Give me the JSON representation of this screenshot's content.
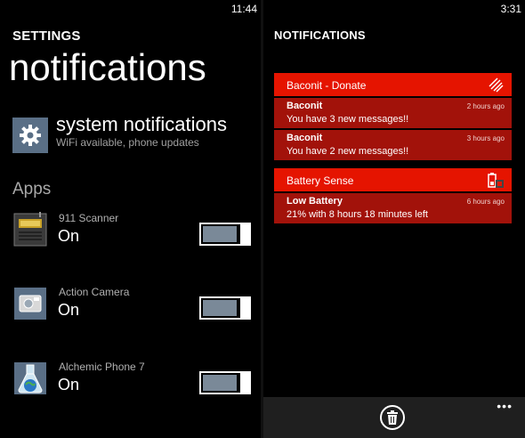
{
  "left": {
    "clock": "11:44",
    "section": "SETTINGS",
    "title": "notifications",
    "system": {
      "name": "system notifications",
      "subtitle": "WiFi available, phone updates",
      "icon": "gear-icon"
    },
    "apps_header": "Apps",
    "apps": [
      {
        "name": "911 Scanner",
        "state": "On",
        "icon": "scanner-radio-icon"
      },
      {
        "name": "Action Camera",
        "state": "On",
        "icon": "camera-icon"
      },
      {
        "name": "Alchemic Phone 7",
        "state": "On",
        "icon": "flask-globe-icon"
      }
    ]
  },
  "right": {
    "clock": "3:31",
    "section": "NOTIFICATIONS",
    "groups": [
      {
        "title": "Baconit - Donate",
        "icon": "baconit-stripes-icon",
        "items": [
          {
            "title": "Baconit",
            "time": "2 hours ago",
            "body": "You have 3 new messages!!"
          },
          {
            "title": "Baconit",
            "time": "3 hours ago",
            "body": "You have 2 new messages!!"
          }
        ]
      },
      {
        "title": "Battery Sense",
        "icon": "battery-icon",
        "items": [
          {
            "title": "Low Battery",
            "time": "6 hours ago",
            "body": "21% with 8 hours 18 minutes left"
          }
        ]
      }
    ],
    "appbar": {
      "trash_icon": "trash-icon",
      "more": "•••"
    }
  },
  "colors": {
    "accent": "#e51400",
    "item_bg": "#a2120a",
    "tile": "#5a6f86",
    "appbar": "#1f1f1f"
  }
}
